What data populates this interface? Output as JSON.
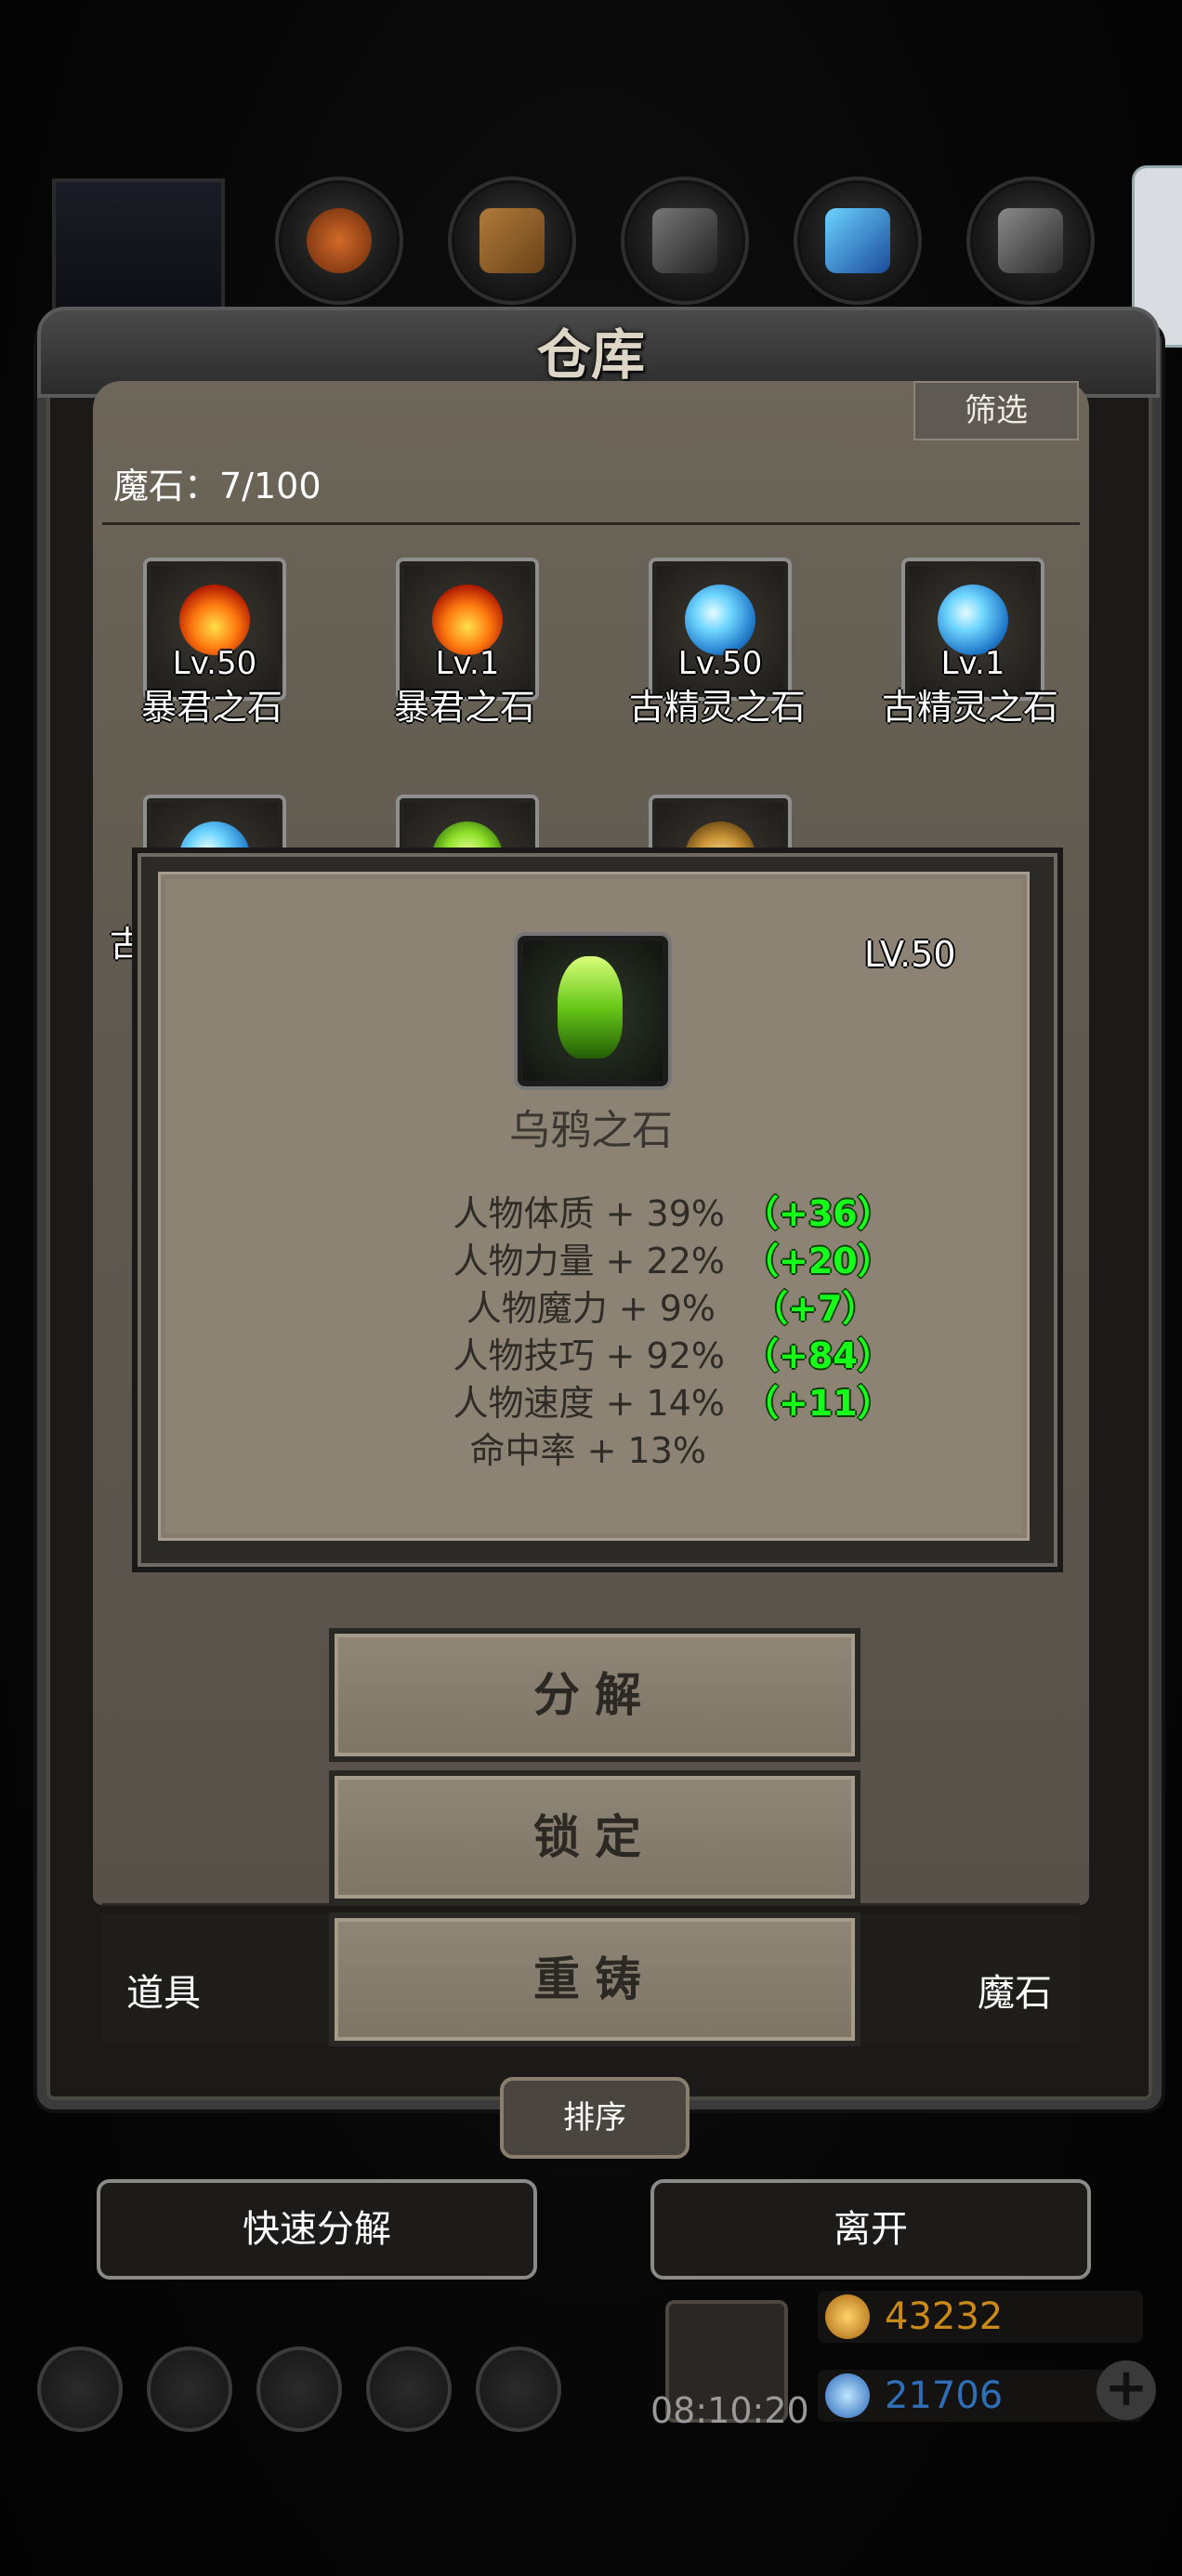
{
  "title": "仓库",
  "filter_label": "筛选",
  "stone_count": "魔石：7/100",
  "items": [
    {
      "level": "Lv.50",
      "name": "暴君之石",
      "kind": "fire"
    },
    {
      "level": "Lv.1",
      "name": "暴君之石",
      "kind": "fire"
    },
    {
      "level": "Lv.50",
      "name": "古精灵之石",
      "kind": "ice"
    },
    {
      "level": "Lv.1",
      "name": "古精灵之石",
      "kind": "ice"
    },
    {
      "level": "",
      "name": "古",
      "kind": "ice"
    },
    {
      "level": "",
      "name": "",
      "kind": "green"
    },
    {
      "level": "",
      "name": "",
      "kind": "gold"
    }
  ],
  "popup": {
    "level": "LV.50",
    "name": "乌鸦之石",
    "stats": [
      {
        "label": "人物体质 + 39%",
        "bonus": "（+36）"
      },
      {
        "label": "人物力量 + 22%",
        "bonus": "（+20）"
      },
      {
        "label": "人物魔力 + 9%",
        "bonus": "（+7）"
      },
      {
        "label": "人物技巧 + 92%",
        "bonus": "（+84）"
      },
      {
        "label": "人物速度 + 14%",
        "bonus": "（+11）"
      },
      {
        "label": "命中率 + 13%",
        "bonus": ""
      }
    ]
  },
  "actions": {
    "decompose": "分解",
    "lock": "锁定",
    "reforge": "重铸"
  },
  "tabs": {
    "items": "道具",
    "stones": "魔石"
  },
  "sort_label": "排序",
  "quick_decompose": "快速分解",
  "leave": "离开",
  "timer": "08:10:20",
  "gold": "43232",
  "gems": "21706",
  "colors": {
    "gold_text": "#c98a1a",
    "gem_text": "#2f6fb8",
    "bonus_green": "#15ff1a"
  }
}
